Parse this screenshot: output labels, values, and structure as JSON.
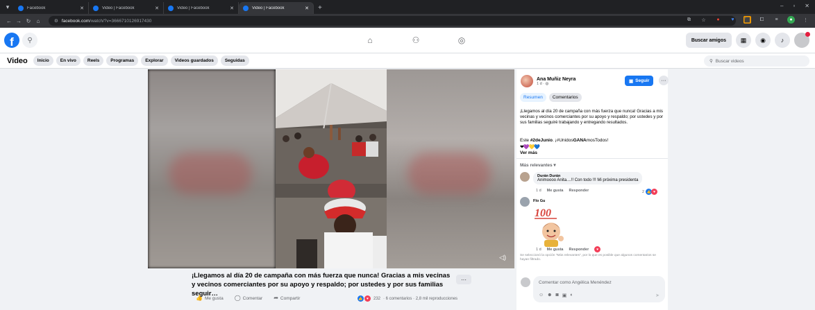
{
  "browser": {
    "tabs": [
      {
        "title": "Facebook",
        "active": false
      },
      {
        "title": "Video | Facebook",
        "active": false
      },
      {
        "title": "Video | Facebook",
        "active": false
      },
      {
        "title": "Video | Facebook",
        "active": true
      }
    ],
    "url_host": "facebook.com",
    "url_path": "/watch/?v=366671012691743​0"
  },
  "header": {
    "find_friends": "Buscar amigos"
  },
  "subnav": {
    "title": "Video",
    "pills": [
      "Inicio",
      "En vivo",
      "Reels",
      "Programas",
      "Explorar",
      "Videos guardados",
      "Seguidas"
    ],
    "search_placeholder": "Buscar videos"
  },
  "video": {
    "caption": "¡Llegamos al día 20 de campaña con más fuerza que nunca! Gracias a mis vecinas y vecinos comerciantes por su apoyo y respaldo; por ustedes y por sus familias seguir…",
    "like_label": "Me gusta",
    "comment_label": "Comentar",
    "share_label": "Compartir",
    "reaction_count": "232",
    "stats": "· 6 comentarios · 2,8 mil reproducciones"
  },
  "panel": {
    "author": "Ana Muñiz Neyra",
    "meta": "1 d · ",
    "follow_label": "Seguir",
    "tabs": [
      "Resumen",
      "Comentarios"
    ],
    "text": "¡Llegamos al día 20 de campaña con más fuerza que nunca! Gracias a mis vecinas y vecinos comerciantes por su apoyo y respaldo; por ustedes y por sus familias seguiré trabajando y entregando resultados.",
    "tags_prefix": "Este ",
    "tag1": "#2deJunio",
    "tags_mid": ". ¡",
    "tag2a": "#Unidos",
    "tag2b": "GANA",
    "tag2c": "mosTodos",
    "tags_suffix": "!",
    "emojis": "❤💜💛💙",
    "ver_mas": "Ver más",
    "sort_label": "Más relevantes ▾",
    "comments": [
      {
        "name": "Durán Durán",
        "text": "Animoooo Anita....!! Con todo !!! Mi próxima presidenta",
        "time": "1 d",
        "like": "Me gusta",
        "reply": "Responder",
        "count": "2"
      },
      {
        "name": "Flo Gu",
        "text": "",
        "time": "1 d",
        "like": "Me gusta",
        "reply": "Responder"
      }
    ],
    "note": "Se seleccionó la opción \"Más relevantes\", por lo que es posible que algunos comentarios se hayan filtrado.",
    "comment_placeholder": "Comentar como Angélica Menéndez"
  }
}
